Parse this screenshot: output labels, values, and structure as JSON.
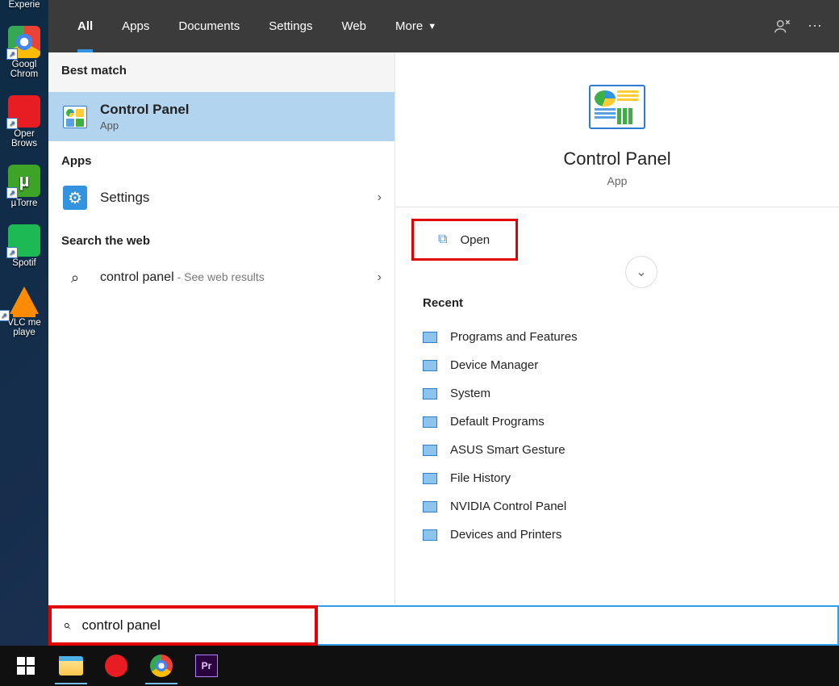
{
  "desktop_icons": [
    {
      "label": "Experie"
    },
    {
      "label": "Googl\nChrom"
    },
    {
      "label": "Oper\nBrows"
    },
    {
      "label": "µTorre"
    },
    {
      "label": "Spotif"
    },
    {
      "label": "VLC me\nplaye"
    }
  ],
  "tabs": {
    "all": "All",
    "apps": "Apps",
    "documents": "Documents",
    "settings": "Settings",
    "web": "Web",
    "more": "More"
  },
  "left": {
    "best_match": "Best match",
    "result_title": "Control Panel",
    "result_sub": "App",
    "apps_header": "Apps",
    "settings_label": "Settings",
    "search_web_header": "Search the web",
    "web_query": "control panel",
    "web_hint": "- See web results"
  },
  "preview": {
    "title": "Control Panel",
    "sub": "App",
    "open": "Open",
    "recent_header": "Recent",
    "recent": [
      "Programs and Features",
      "Device Manager",
      "System",
      "Default Programs",
      "ASUS Smart Gesture",
      "File History",
      "NVIDIA Control Panel",
      "Devices and Printers"
    ]
  },
  "search_value": "control panel",
  "taskbar": {
    "pr": "Pr"
  }
}
